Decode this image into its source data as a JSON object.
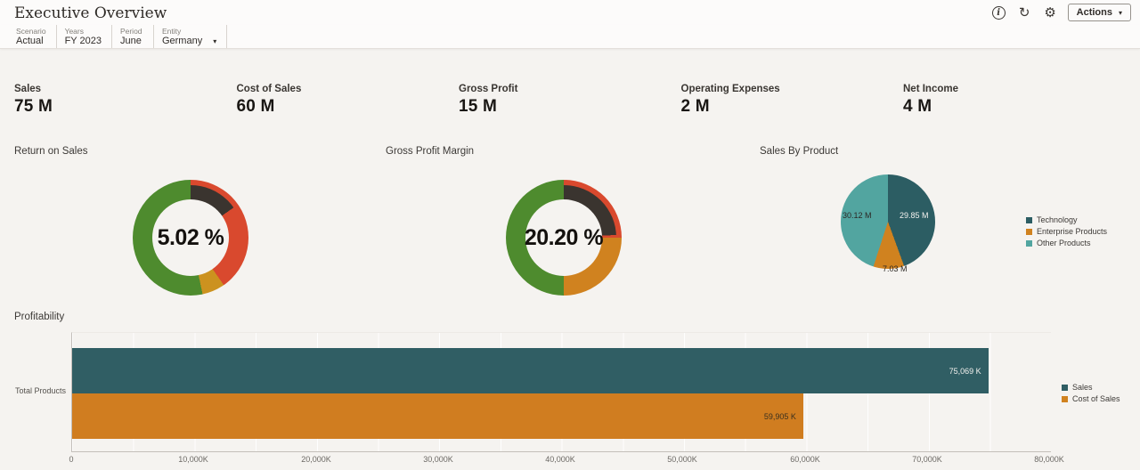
{
  "header": {
    "title": "Executive Overview",
    "info_icon": "i",
    "refresh_icon": "↻",
    "gear_icon": "⚙",
    "actions_label": "Actions",
    "caret": "▾"
  },
  "pov": {
    "items": [
      {
        "dimension": "Scenario",
        "member": "Actual"
      },
      {
        "dimension": "Years",
        "member": "FY 2023"
      },
      {
        "dimension": "Period",
        "member": "June"
      },
      {
        "dimension": "Entity",
        "member": "Germany"
      }
    ],
    "entity_caret": "▾"
  },
  "kpis": [
    {
      "label": "Sales",
      "value": "75 M"
    },
    {
      "label": "Cost of Sales",
      "value": "60 M"
    },
    {
      "label": "Gross Profit",
      "value": "15 M"
    },
    {
      "label": "Operating Expenses",
      "value": "2 M"
    },
    {
      "label": "Net Income",
      "value": "4 M"
    }
  ],
  "gauges": [
    {
      "title": "Return on Sales",
      "value": "5.02 %"
    },
    {
      "title": "Gross Profit Margin",
      "value": "20.20 %"
    }
  ],
  "pie": {
    "title": "Sales By Product",
    "labels": {
      "technology": "29.85 M",
      "other": "30.12 M",
      "enterprise": "7.03 M"
    },
    "legend": [
      {
        "label": "Technology",
        "color": "#2c5d63"
      },
      {
        "label": "Enterprise Products",
        "color": "#d0821f"
      },
      {
        "label": "Other Products",
        "color": "#52a5a0"
      }
    ]
  },
  "bar_chart": {
    "title": "Profitability",
    "category": "Total Products",
    "sales_label": "75,069 K",
    "cos_label": "59,905 K",
    "legend": [
      {
        "label": "Sales",
        "color": "#305e64"
      },
      {
        "label": "Cost of Sales",
        "color": "#d07d20"
      }
    ],
    "ticks": [
      "0",
      "10,000K",
      "20,000K",
      "30,000K",
      "40,000K",
      "50,000K",
      "60,000K",
      "70,000K",
      "80,000K"
    ]
  },
  "colors": {
    "gauge_green": "#4e8b2e",
    "gauge_red": "#d9492e",
    "gauge_amber": "#cc921f",
    "gauge_indicator": "#3a342f",
    "teal_dark": "#2c5d63",
    "teal_light": "#52a5a0",
    "orange": "#d0821f"
  },
  "chart_data": [
    {
      "type": "gauge",
      "title": "Return on Sales",
      "value": 5.02,
      "unit": "%"
    },
    {
      "type": "gauge",
      "title": "Gross Profit Margin",
      "value": 20.2,
      "unit": "%"
    },
    {
      "type": "pie",
      "title": "Sales By Product",
      "labels": [
        "Technology",
        "Enterprise Products",
        "Other Products"
      ],
      "values": [
        29.85,
        7.03,
        30.12
      ],
      "unit": "M",
      "legend_position": "right"
    },
    {
      "type": "bar",
      "title": "Profitability",
      "orientation": "horizontal",
      "categories": [
        "Total Products"
      ],
      "series": [
        {
          "name": "Sales",
          "values": [
            75069
          ]
        },
        {
          "name": "Cost of Sales",
          "values": [
            59905
          ]
        }
      ],
      "unit": "K",
      "xlim": [
        0,
        80000
      ],
      "xticks": [
        0,
        10000,
        20000,
        30000,
        40000,
        50000,
        60000,
        70000,
        80000
      ],
      "grid": true,
      "legend_position": "right"
    }
  ]
}
